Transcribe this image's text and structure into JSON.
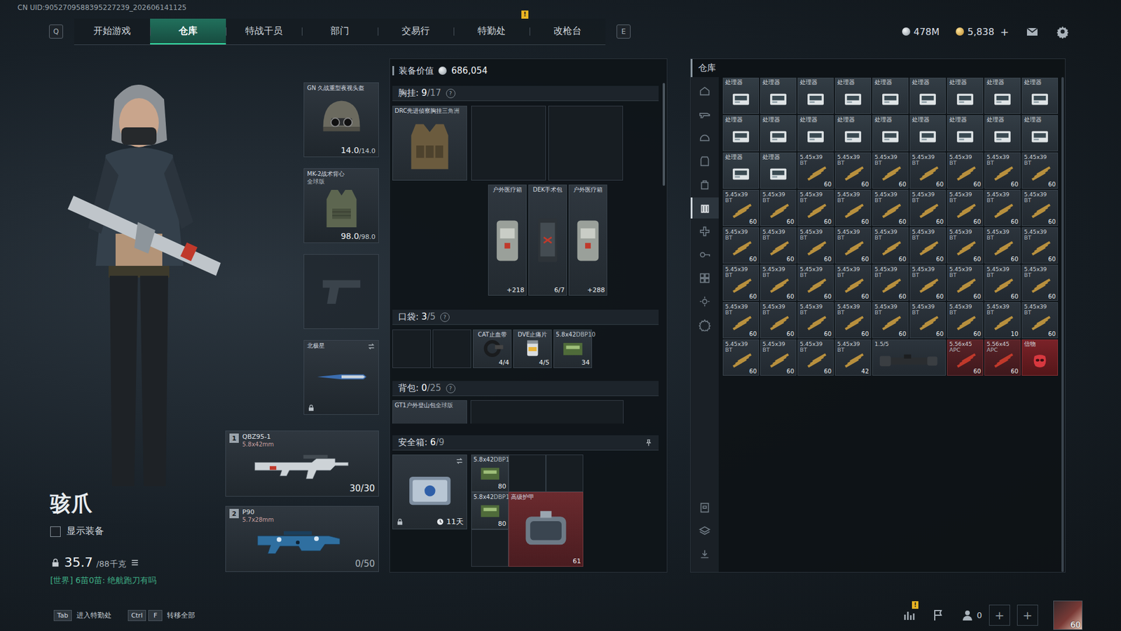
{
  "uid": "CN UID:9052709588395227239_202606141125",
  "nav": {
    "left_key": "Q",
    "right_key": "E",
    "tabs": [
      {
        "label": "开始游戏",
        "selected": false
      },
      {
        "label": "仓库",
        "selected": true
      },
      {
        "label": "特战干员",
        "selected": false
      },
      {
        "label": "部门",
        "selected": false
      },
      {
        "label": "交易行",
        "selected": false
      },
      {
        "label": "特勤处",
        "selected": false,
        "badge": "!"
      },
      {
        "label": "改枪台",
        "selected": false
      }
    ]
  },
  "currency": [
    {
      "kind": "silver",
      "value": "478M"
    },
    {
      "kind": "gold",
      "value": "5,838",
      "action": "+"
    }
  ],
  "character": {
    "name": "骇爪",
    "show_gear": {
      "label": "显示装备",
      "checked": false
    },
    "weight": {
      "current": "35.7",
      "max": "/88千克"
    },
    "chat": "[世界] 6苗0苗: 绝航跑刀有吗"
  },
  "equipment": [
    {
      "kind": "helmet",
      "name": "GN 久战重型夜视头盔",
      "current": "14.0",
      "max": "/14.0",
      "empty": false,
      "locked": false,
      "swap": false
    },
    {
      "kind": "armor",
      "name": "MK-2战术背心",
      "sub": "全球版",
      "current": "98.0",
      "max": "/98.0",
      "empty": false,
      "locked": false,
      "swap": false
    },
    {
      "kind": "pistol",
      "empty": true,
      "locked": false,
      "swap": false
    },
    {
      "kind": "melee",
      "name": "北极星",
      "empty": false,
      "locked": true,
      "swap": true
    }
  ],
  "weapons": [
    {
      "slot": "1",
      "name": "QBZ95-1",
      "caliber": "5.8x42mm",
      "ammo": "30/30",
      "kind": "rifle"
    },
    {
      "slot": "2",
      "name": "P90",
      "caliber": "5.7x28mm",
      "ammo": "0/50",
      "kind": "smg"
    }
  ],
  "loadout": {
    "value_label": "装备价值",
    "value": "686,054",
    "chest": {
      "label": "胸挂:",
      "count": "9",
      "capacity": "/17",
      "help": "?",
      "rig": {
        "name": "DRC先进侦察胸挂",
        "sub": "三角洲"
      },
      "blocks": [
        {
          "kind": "empty"
        },
        {
          "kind": "empty"
        }
      ],
      "items": [
        {
          "kind": "medkit",
          "name": "户外医疗箱",
          "value": "+218"
        },
        {
          "kind": "surgery",
          "name": "DEK手术包",
          "value": "6/7"
        },
        {
          "kind": "medkit",
          "name": "户外医疗箱",
          "value": "+288"
        }
      ]
    },
    "pockets": {
      "label": "口袋:",
      "count": "3",
      "capacity": "/5",
      "help": "?",
      "cells": [
        {
          "kind": "empty"
        },
        {
          "kind": "empty"
        },
        {
          "kind": "tourniquet",
          "name": "CAT止血带",
          "value": "4/4"
        },
        {
          "kind": "painkiller",
          "name": "DVE止痛片",
          "value": "4/5"
        },
        {
          "kind": "ammo",
          "caliber": "5.8x42",
          "type": "DBP10",
          "value": "34"
        }
      ]
    },
    "backpack": {
      "label": "背包:",
      "count": "0",
      "capacity": "/25",
      "help": "?",
      "bag": {
        "name": "GT1户外登山包",
        "sub": "全球版"
      }
    },
    "safe": {
      "label": "安全箱:",
      "count": "6",
      "capacity": "/9",
      "help": "?",
      "box": {
        "time": "11天",
        "locked": true
      },
      "cells": [
        {
          "kind": "ammo",
          "caliber": "5.8x42",
          "type": "DBP10",
          "value": "80"
        },
        {
          "kind": "empty"
        },
        {
          "kind": "empty"
        },
        {
          "kind": "ammo",
          "caliber": "5.8x42",
          "type": "DBP10",
          "value": "80"
        },
        {
          "kind": "armor",
          "name": "高级护甲",
          "value": "61"
        },
        {
          "kind": "empty"
        }
      ]
    }
  },
  "warehouse": {
    "title": "仓库",
    "sidebar_top": [
      {
        "kind": "home",
        "selected": false
      },
      {
        "kind": "weapon",
        "selected": false
      },
      {
        "kind": "helmet",
        "selected": false
      },
      {
        "kind": "armor",
        "selected": false
      },
      {
        "kind": "bag",
        "selected": false
      },
      {
        "kind": "ammo",
        "selected": true
      },
      {
        "kind": "medical",
        "selected": false
      },
      {
        "kind": "key",
        "selected": false
      },
      {
        "kind": "misc",
        "selected": false
      },
      {
        "kind": "gear",
        "selected": false
      },
      {
        "kind": "settings",
        "selected": false
      }
    ],
    "sidebar_bottom": [
      {
        "kind": "storage",
        "selected": false
      },
      {
        "kind": "layers",
        "selected": false
      },
      {
        "kind": "transfer",
        "selected": false
      }
    ],
    "items": [
      {
        "kind": "processor",
        "label": "处理器"
      },
      {
        "kind": "processor",
        "label": "处理器"
      },
      {
        "kind": "processor",
        "label": "处理器"
      },
      {
        "kind": "processor",
        "label": "处理器"
      },
      {
        "kind": "processor",
        "label": "处理器"
      },
      {
        "kind": "processor",
        "label": "处理器"
      },
      {
        "kind": "processor",
        "label": "处理器"
      },
      {
        "kind": "processor",
        "label": "处理器"
      },
      {
        "kind": "processor",
        "label": "处理器"
      },
      {
        "kind": "processor",
        "label": "处理器"
      },
      {
        "kind": "processor",
        "label": "处理器"
      },
      {
        "kind": "processor",
        "label": "处理器"
      },
      {
        "kind": "processor",
        "label": "处理器"
      },
      {
        "kind": "processor",
        "label": "处理器"
      },
      {
        "kind": "processor",
        "label": "处理器"
      },
      {
        "kind": "processor",
        "label": "处理器"
      },
      {
        "kind": "processor",
        "label": "处理器"
      },
      {
        "kind": "processor",
        "label": "处理器"
      },
      {
        "kind": "processor",
        "label": "处理器"
      },
      {
        "kind": "processor",
        "label": "处理器"
      },
      {
        "kind": "ammo",
        "caliber": "5.45x39",
        "type": "BT",
        "count": "60"
      },
      {
        "kind": "ammo",
        "caliber": "5.45x39",
        "type": "BT",
        "count": "60"
      },
      {
        "kind": "ammo",
        "caliber": "5.45x39",
        "type": "BT",
        "count": "60"
      },
      {
        "kind": "ammo",
        "caliber": "5.45x39",
        "type": "BT",
        "count": "60"
      },
      {
        "kind": "ammo",
        "caliber": "5.45x39",
        "type": "BT",
        "count": "60"
      },
      {
        "kind": "ammo",
        "caliber": "5.45x39",
        "type": "BT",
        "count": "60"
      },
      {
        "kind": "ammo",
        "caliber": "5.45x39",
        "type": "BT",
        "count": "60"
      },
      {
        "kind": "ammo",
        "caliber": "5.45x39",
        "type": "BT",
        "count": "60"
      },
      {
        "kind": "ammo",
        "caliber": "5.45x39",
        "type": "BT",
        "count": "60"
      },
      {
        "kind": "ammo",
        "caliber": "5.45x39",
        "type": "BT",
        "count": "60"
      },
      {
        "kind": "ammo",
        "caliber": "5.45x39",
        "type": "BT",
        "count": "60"
      },
      {
        "kind": "ammo",
        "caliber": "5.45x39",
        "type": "BT",
        "count": "60"
      },
      {
        "kind": "ammo",
        "caliber": "5.45x39",
        "type": "BT",
        "count": "60"
      },
      {
        "kind": "ammo",
        "caliber": "5.45x39",
        "type": "BT",
        "count": "60"
      },
      {
        "kind": "ammo",
        "caliber": "5.45x39",
        "type": "BT",
        "count": "60"
      },
      {
        "kind": "ammo",
        "caliber": "5.45x39",
        "type": "BT",
        "count": "60"
      },
      {
        "kind": "ammo",
        "caliber": "5.45x39",
        "type": "BT",
        "count": "60"
      },
      {
        "kind": "ammo",
        "caliber": "5.45x39",
        "type": "BT",
        "count": "60"
      },
      {
        "kind": "ammo",
        "caliber": "5.45x39",
        "type": "BT",
        "count": "60"
      },
      {
        "kind": "ammo",
        "caliber": "5.45x39",
        "type": "BT",
        "count": "60"
      },
      {
        "kind": "ammo",
        "caliber": "5.45x39",
        "type": "BT",
        "count": "60"
      },
      {
        "kind": "ammo",
        "caliber": "5.45x39",
        "type": "BT",
        "count": "60"
      },
      {
        "kind": "ammo",
        "caliber": "5.45x39",
        "type": "BT",
        "count": "60"
      },
      {
        "kind": "ammo",
        "caliber": "5.45x39",
        "type": "BT",
        "count": "60"
      },
      {
        "kind": "ammo",
        "caliber": "5.45x39",
        "type": "BT",
        "count": "60"
      },
      {
        "kind": "ammo",
        "caliber": "5.45x39",
        "type": "BT",
        "count": "60"
      },
      {
        "kind": "ammo",
        "caliber": "5.45x39",
        "type": "BT",
        "count": "60"
      },
      {
        "kind": "ammo",
        "caliber": "5.45x39",
        "type": "BT",
        "count": "60"
      },
      {
        "kind": "ammo",
        "caliber": "5.45x39",
        "type": "BT",
        "count": "60"
      },
      {
        "kind": "ammo",
        "caliber": "5.45x39",
        "type": "BT",
        "count": "60"
      },
      {
        "kind": "ammo",
        "caliber": "5.45x39",
        "type": "BT",
        "count": "60"
      },
      {
        "kind": "ammo",
        "caliber": "5.45x39",
        "type": "BT",
        "count": "60"
      },
      {
        "kind": "ammo",
        "caliber": "5.45x39",
        "type": "BT",
        "count": "60"
      },
      {
        "kind": "ammo",
        "caliber": "5.45x39",
        "type": "BT",
        "count": "60"
      },
      {
        "kind": "ammo",
        "caliber": "5.45x39",
        "type": "BT",
        "count": "60"
      },
      {
        "kind": "ammo",
        "caliber": "5.45x39",
        "type": "BT",
        "count": "60"
      },
      {
        "kind": "ammo",
        "caliber": "5.45x39",
        "type": "BT",
        "count": "60"
      },
      {
        "kind": "ammo",
        "caliber": "5.45x39",
        "type": "BT",
        "count": "60"
      },
      {
        "kind": "ammo",
        "caliber": "5.45x39",
        "type": "BT",
        "count": "60"
      },
      {
        "kind": "ammo",
        "caliber": "5.45x39",
        "type": "BT",
        "count": "60"
      },
      {
        "kind": "ammo",
        "caliber": "5.45x39",
        "type": "BT",
        "count": "60"
      },
      {
        "kind": "ammo",
        "caliber": "5.45x39",
        "type": "BT",
        "count": "10"
      },
      {
        "kind": "ammo",
        "caliber": "5.45x39",
        "type": "BT",
        "count": "60"
      },
      {
        "kind": "ammo",
        "caliber": "5.45x39",
        "type": "BT",
        "count": "60"
      },
      {
        "kind": "ammo",
        "caliber": "5.45x39",
        "type": "BT",
        "count": "60"
      },
      {
        "kind": "ammo",
        "caliber": "5.45x39",
        "type": "BT",
        "count": "60"
      },
      {
        "kind": "ammo",
        "caliber": "5.45x39",
        "type": "BT",
        "count": "42"
      },
      {
        "kind": "scope",
        "label": "1.5/5"
      },
      {
        "kind": "rare-ammo",
        "caliber": "5.56x45",
        "type": "APC",
        "count": "60"
      },
      {
        "kind": "rare-ammo",
        "caliber": "5.56x45",
        "type": "APC",
        "count": "60"
      },
      {
        "kind": "token",
        "label": "信物"
      }
    ]
  },
  "footer": {
    "hints": [
      {
        "keys": [
          "Tab"
        ],
        "label": "进入特勤处"
      },
      {
        "keys": [
          "Ctrl",
          "F"
        ],
        "label": "转移全部"
      }
    ],
    "stats_badge": "!",
    "friends": "0",
    "add_slots": [
      "+",
      "+"
    ],
    "level": "60"
  }
}
